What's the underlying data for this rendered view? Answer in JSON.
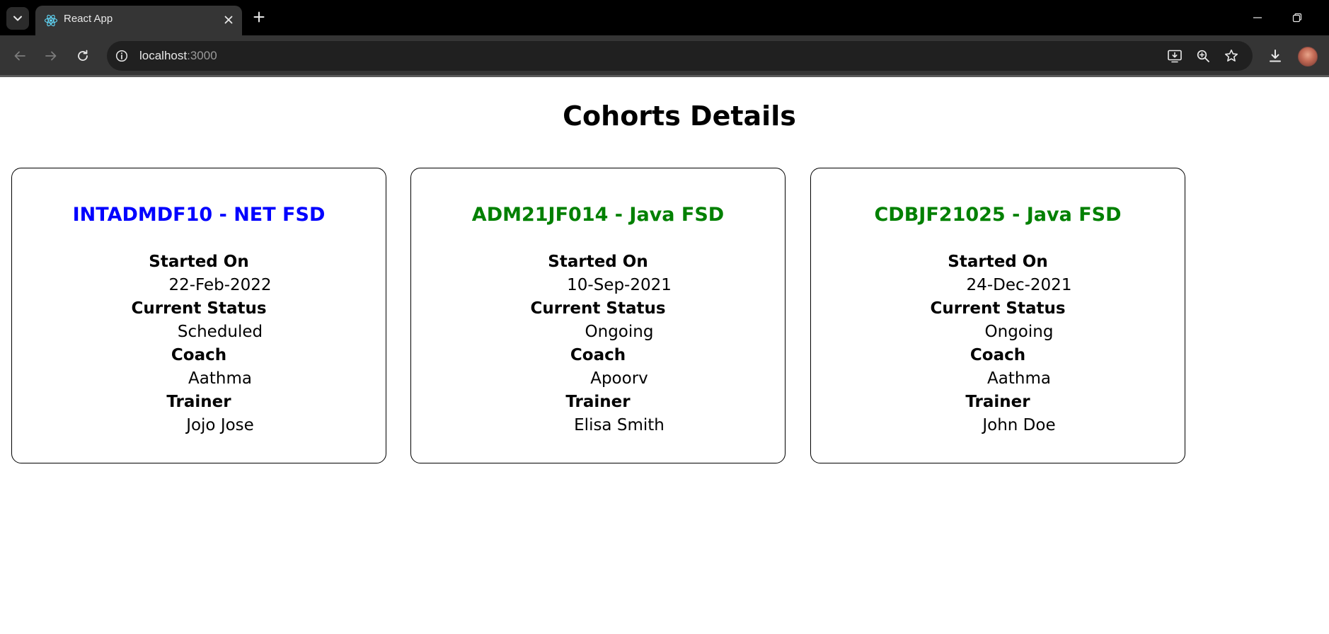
{
  "browser": {
    "tab_title": "React App",
    "url_host": "localhost",
    "url_port": ":3000"
  },
  "page": {
    "title": "Cohorts Details"
  },
  "labels": {
    "started_on": "Started On",
    "current_status": "Current Status",
    "coach": "Coach",
    "trainer": "Trainer"
  },
  "cohorts": [
    {
      "title": "INTADMDF10 - NET FSD",
      "title_color": "#0000ff",
      "started_on": "22-Feb-2022",
      "current_status": "Scheduled",
      "coach": "Aathma",
      "trainer": "Jojo Jose"
    },
    {
      "title": "ADM21JF014 - Java FSD",
      "title_color": "#008000",
      "started_on": "10-Sep-2021",
      "current_status": "Ongoing",
      "coach": "Apoorv",
      "trainer": "Elisa Smith"
    },
    {
      "title": "CDBJF21025 - Java FSD",
      "title_color": "#008000",
      "started_on": "24-Dec-2021",
      "current_status": "Ongoing",
      "coach": "Aathma",
      "trainer": "John Doe"
    }
  ]
}
